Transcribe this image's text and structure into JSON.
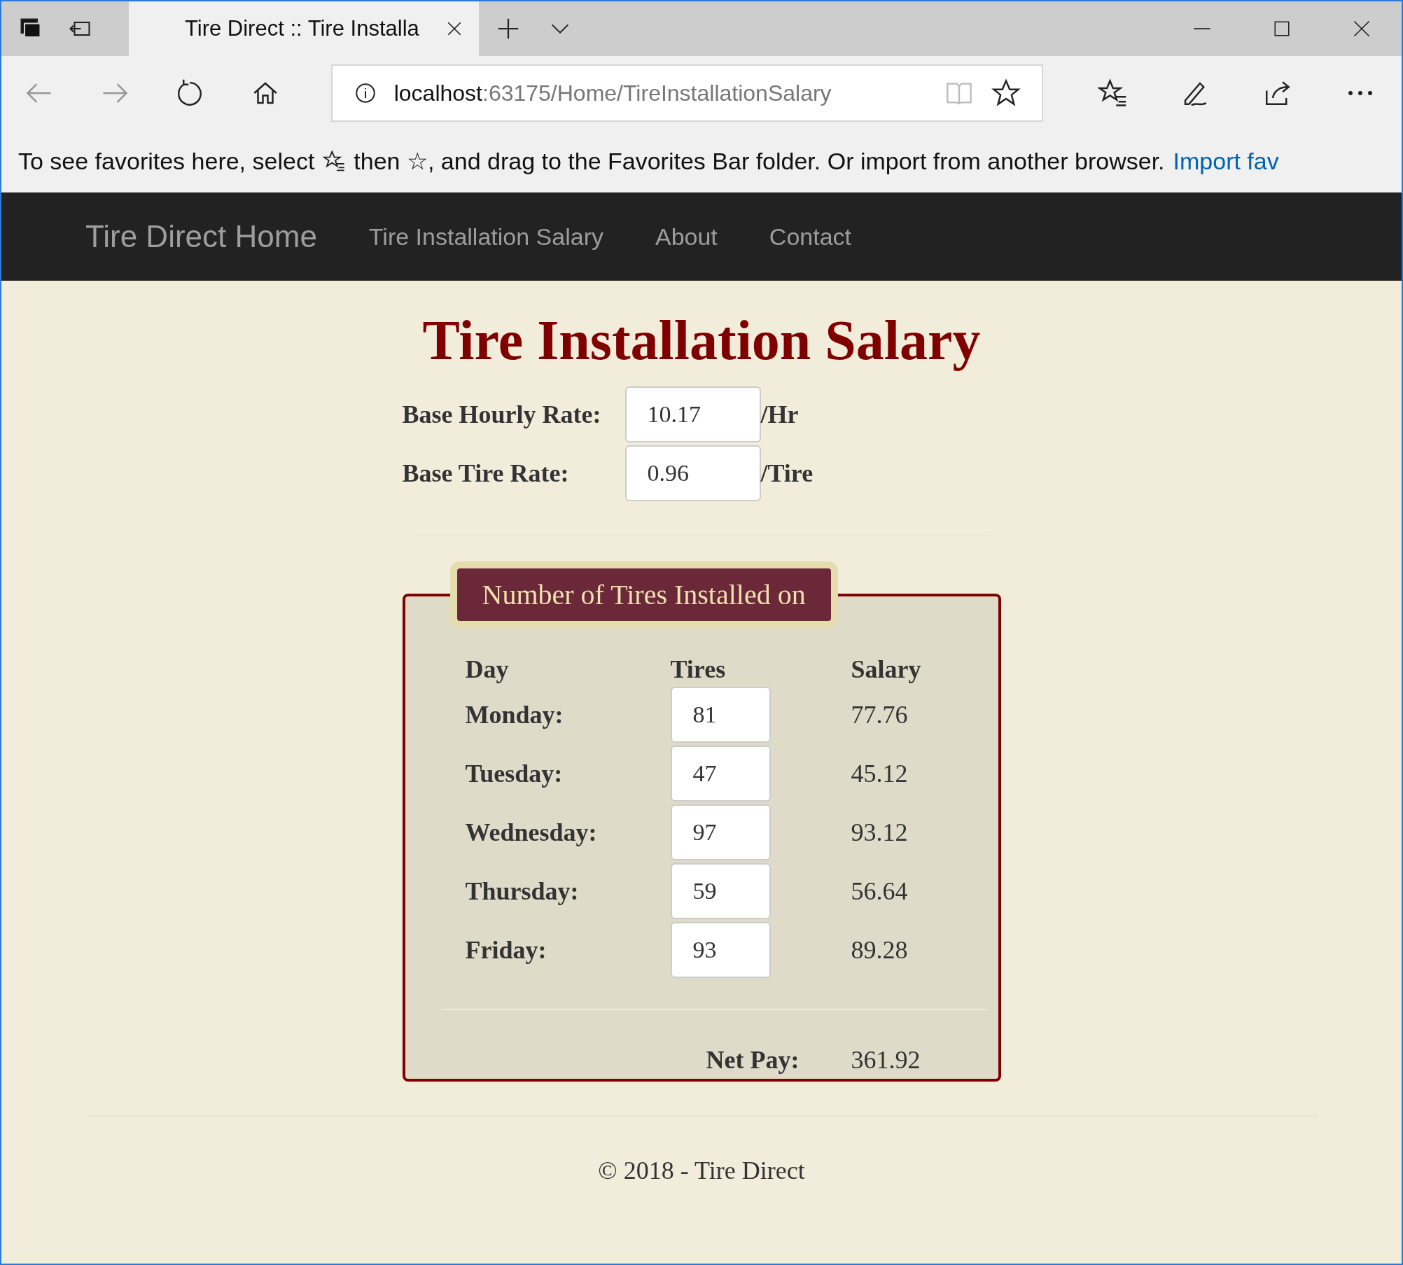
{
  "browser": {
    "tab_title": "Tire Direct :: Tire Installa",
    "address_host": "localhost",
    "address_path": ":63175/Home/TireInstallationSalary",
    "favorites_text_before": "To see favorites here, select",
    "favorites_text_after": "then ☆, and drag to the Favorites Bar folder. Or import from another browser.",
    "favorites_link": "Import fav"
  },
  "navbar": {
    "brand": "Tire Direct Home",
    "links": [
      "Tire Installation Salary",
      "About",
      "Contact"
    ]
  },
  "page_title": "Tire Installation Salary",
  "rates": [
    {
      "label": "Base Hourly Rate:",
      "value": "10.17",
      "unit": "/Hr"
    },
    {
      "label": "Base Tire Rate:",
      "value": "0.96",
      "unit": "/Tire"
    }
  ],
  "tires_panel": {
    "legend": "Number of Tires Installed on",
    "columns": [
      "Day",
      "Tires",
      "Salary"
    ],
    "rows": [
      {
        "day": "Monday:",
        "tires": "81",
        "salary": "77.76"
      },
      {
        "day": "Tuesday:",
        "tires": "47",
        "salary": "45.12"
      },
      {
        "day": "Wednesday:",
        "tires": "97",
        "salary": "93.12"
      },
      {
        "day": "Thursday:",
        "tires": "59",
        "salary": "56.64"
      },
      {
        "day": "Friday:",
        "tires": "93",
        "salary": "89.28"
      }
    ],
    "net_pay_label": "Net Pay:",
    "net_pay": "361.92"
  },
  "footer": "© 2018 - Tire Direct"
}
